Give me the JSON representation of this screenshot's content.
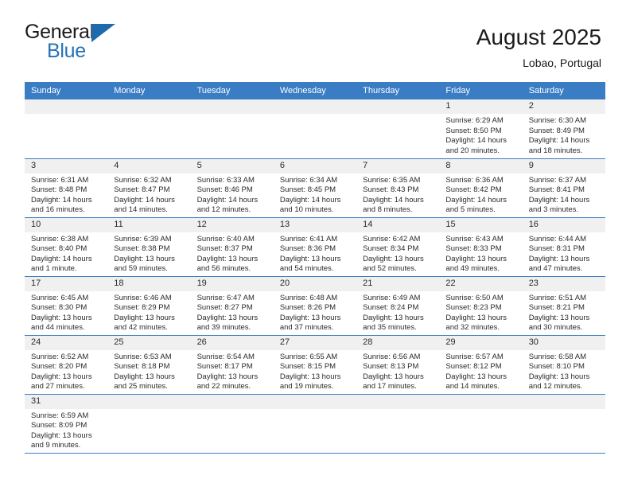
{
  "logo": {
    "word_top": "General",
    "word_bottom": "Blue",
    "triangle_color": "#1f69ad",
    "blue_text_color": "#2572b8"
  },
  "header": {
    "title": "August 2025",
    "subtitle": "Lobao, Portugal"
  },
  "theme": {
    "header_bg": "#3a7dc4",
    "daynum_bg": "#f0f0f0",
    "row_border": "#3a7dc4"
  },
  "weekdays": [
    "Sunday",
    "Monday",
    "Tuesday",
    "Wednesday",
    "Thursday",
    "Friday",
    "Saturday"
  ],
  "weeks": [
    [
      {
        "day": "",
        "empty": true
      },
      {
        "day": "",
        "empty": true
      },
      {
        "day": "",
        "empty": true
      },
      {
        "day": "",
        "empty": true
      },
      {
        "day": "",
        "empty": true
      },
      {
        "day": "1",
        "sunrise": "Sunrise: 6:29 AM",
        "sunset": "Sunset: 8:50 PM",
        "daylight": "Daylight: 14 hours and 20 minutes."
      },
      {
        "day": "2",
        "sunrise": "Sunrise: 6:30 AM",
        "sunset": "Sunset: 8:49 PM",
        "daylight": "Daylight: 14 hours and 18 minutes."
      }
    ],
    [
      {
        "day": "3",
        "sunrise": "Sunrise: 6:31 AM",
        "sunset": "Sunset: 8:48 PM",
        "daylight": "Daylight: 14 hours and 16 minutes."
      },
      {
        "day": "4",
        "sunrise": "Sunrise: 6:32 AM",
        "sunset": "Sunset: 8:47 PM",
        "daylight": "Daylight: 14 hours and 14 minutes."
      },
      {
        "day": "5",
        "sunrise": "Sunrise: 6:33 AM",
        "sunset": "Sunset: 8:46 PM",
        "daylight": "Daylight: 14 hours and 12 minutes."
      },
      {
        "day": "6",
        "sunrise": "Sunrise: 6:34 AM",
        "sunset": "Sunset: 8:45 PM",
        "daylight": "Daylight: 14 hours and 10 minutes."
      },
      {
        "day": "7",
        "sunrise": "Sunrise: 6:35 AM",
        "sunset": "Sunset: 8:43 PM",
        "daylight": "Daylight: 14 hours and 8 minutes."
      },
      {
        "day": "8",
        "sunrise": "Sunrise: 6:36 AM",
        "sunset": "Sunset: 8:42 PM",
        "daylight": "Daylight: 14 hours and 5 minutes."
      },
      {
        "day": "9",
        "sunrise": "Sunrise: 6:37 AM",
        "sunset": "Sunset: 8:41 PM",
        "daylight": "Daylight: 14 hours and 3 minutes."
      }
    ],
    [
      {
        "day": "10",
        "sunrise": "Sunrise: 6:38 AM",
        "sunset": "Sunset: 8:40 PM",
        "daylight": "Daylight: 14 hours and 1 minute."
      },
      {
        "day": "11",
        "sunrise": "Sunrise: 6:39 AM",
        "sunset": "Sunset: 8:38 PM",
        "daylight": "Daylight: 13 hours and 59 minutes."
      },
      {
        "day": "12",
        "sunrise": "Sunrise: 6:40 AM",
        "sunset": "Sunset: 8:37 PM",
        "daylight": "Daylight: 13 hours and 56 minutes."
      },
      {
        "day": "13",
        "sunrise": "Sunrise: 6:41 AM",
        "sunset": "Sunset: 8:36 PM",
        "daylight": "Daylight: 13 hours and 54 minutes."
      },
      {
        "day": "14",
        "sunrise": "Sunrise: 6:42 AM",
        "sunset": "Sunset: 8:34 PM",
        "daylight": "Daylight: 13 hours and 52 minutes."
      },
      {
        "day": "15",
        "sunrise": "Sunrise: 6:43 AM",
        "sunset": "Sunset: 8:33 PM",
        "daylight": "Daylight: 13 hours and 49 minutes."
      },
      {
        "day": "16",
        "sunrise": "Sunrise: 6:44 AM",
        "sunset": "Sunset: 8:31 PM",
        "daylight": "Daylight: 13 hours and 47 minutes."
      }
    ],
    [
      {
        "day": "17",
        "sunrise": "Sunrise: 6:45 AM",
        "sunset": "Sunset: 8:30 PM",
        "daylight": "Daylight: 13 hours and 44 minutes."
      },
      {
        "day": "18",
        "sunrise": "Sunrise: 6:46 AM",
        "sunset": "Sunset: 8:29 PM",
        "daylight": "Daylight: 13 hours and 42 minutes."
      },
      {
        "day": "19",
        "sunrise": "Sunrise: 6:47 AM",
        "sunset": "Sunset: 8:27 PM",
        "daylight": "Daylight: 13 hours and 39 minutes."
      },
      {
        "day": "20",
        "sunrise": "Sunrise: 6:48 AM",
        "sunset": "Sunset: 8:26 PM",
        "daylight": "Daylight: 13 hours and 37 minutes."
      },
      {
        "day": "21",
        "sunrise": "Sunrise: 6:49 AM",
        "sunset": "Sunset: 8:24 PM",
        "daylight": "Daylight: 13 hours and 35 minutes."
      },
      {
        "day": "22",
        "sunrise": "Sunrise: 6:50 AM",
        "sunset": "Sunset: 8:23 PM",
        "daylight": "Daylight: 13 hours and 32 minutes."
      },
      {
        "day": "23",
        "sunrise": "Sunrise: 6:51 AM",
        "sunset": "Sunset: 8:21 PM",
        "daylight": "Daylight: 13 hours and 30 minutes."
      }
    ],
    [
      {
        "day": "24",
        "sunrise": "Sunrise: 6:52 AM",
        "sunset": "Sunset: 8:20 PM",
        "daylight": "Daylight: 13 hours and 27 minutes."
      },
      {
        "day": "25",
        "sunrise": "Sunrise: 6:53 AM",
        "sunset": "Sunset: 8:18 PM",
        "daylight": "Daylight: 13 hours and 25 minutes."
      },
      {
        "day": "26",
        "sunrise": "Sunrise: 6:54 AM",
        "sunset": "Sunset: 8:17 PM",
        "daylight": "Daylight: 13 hours and 22 minutes."
      },
      {
        "day": "27",
        "sunrise": "Sunrise: 6:55 AM",
        "sunset": "Sunset: 8:15 PM",
        "daylight": "Daylight: 13 hours and 19 minutes."
      },
      {
        "day": "28",
        "sunrise": "Sunrise: 6:56 AM",
        "sunset": "Sunset: 8:13 PM",
        "daylight": "Daylight: 13 hours and 17 minutes."
      },
      {
        "day": "29",
        "sunrise": "Sunrise: 6:57 AM",
        "sunset": "Sunset: 8:12 PM",
        "daylight": "Daylight: 13 hours and 14 minutes."
      },
      {
        "day": "30",
        "sunrise": "Sunrise: 6:58 AM",
        "sunset": "Sunset: 8:10 PM",
        "daylight": "Daylight: 13 hours and 12 minutes."
      }
    ],
    [
      {
        "day": "31",
        "sunrise": "Sunrise: 6:59 AM",
        "sunset": "Sunset: 8:09 PM",
        "daylight": "Daylight: 13 hours and 9 minutes."
      },
      {
        "day": "",
        "empty": true
      },
      {
        "day": "",
        "empty": true
      },
      {
        "day": "",
        "empty": true
      },
      {
        "day": "",
        "empty": true
      },
      {
        "day": "",
        "empty": true
      },
      {
        "day": "",
        "empty": true
      }
    ]
  ]
}
